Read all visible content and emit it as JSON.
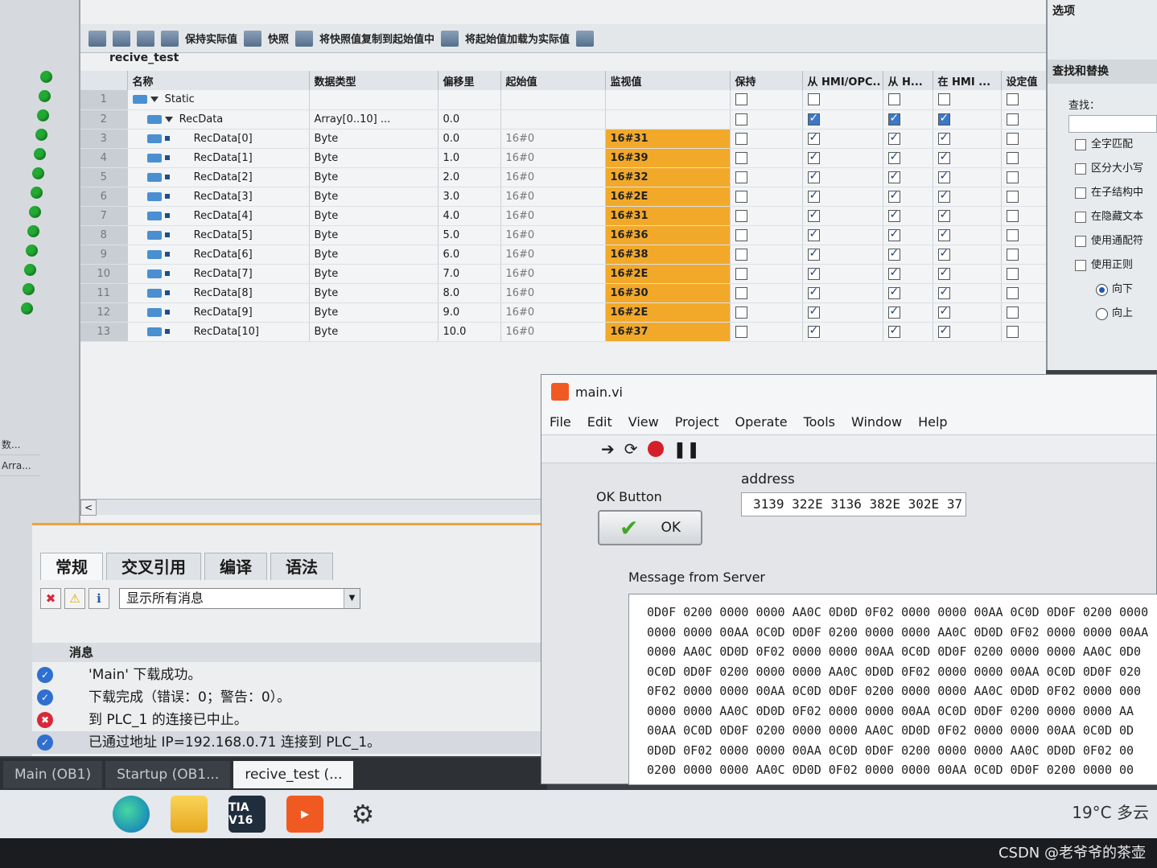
{
  "toolbar": {
    "keep_actual": "保持实际值",
    "snapshot": "快照",
    "copy_snapshot": "将快照值复制到起始值中",
    "load_start": "将起始值加载为实际值"
  },
  "block": {
    "title": "recive_test"
  },
  "grid": {
    "headers": [
      "名称",
      "数据类型",
      "偏移里",
      "起始值",
      "监视值",
      "保持",
      "从 HMI/OPC..",
      "从 H...",
      "在 HMI ...",
      "设定值"
    ],
    "static_row": {
      "num": "1",
      "name": "Static"
    },
    "array_row": {
      "num": "2",
      "name": "RecData",
      "type": "Array[0..10] ...",
      "offset": "0.0"
    },
    "rows": [
      {
        "num": "3",
        "name": "RecData[0]",
        "type": "Byte",
        "offset": "0.0",
        "start": "16#0",
        "monitor": "16#31"
      },
      {
        "num": "4",
        "name": "RecData[1]",
        "type": "Byte",
        "offset": "1.0",
        "start": "16#0",
        "monitor": "16#39"
      },
      {
        "num": "5",
        "name": "RecData[2]",
        "type": "Byte",
        "offset": "2.0",
        "start": "16#0",
        "monitor": "16#32"
      },
      {
        "num": "6",
        "name": "RecData[3]",
        "type": "Byte",
        "offset": "3.0",
        "start": "16#0",
        "monitor": "16#2E"
      },
      {
        "num": "7",
        "name": "RecData[4]",
        "type": "Byte",
        "offset": "4.0",
        "start": "16#0",
        "monitor": "16#31"
      },
      {
        "num": "8",
        "name": "RecData[5]",
        "type": "Byte",
        "offset": "5.0",
        "start": "16#0",
        "monitor": "16#36"
      },
      {
        "num": "9",
        "name": "RecData[6]",
        "type": "Byte",
        "offset": "6.0",
        "start": "16#0",
        "monitor": "16#38"
      },
      {
        "num": "10",
        "name": "RecData[7]",
        "type": "Byte",
        "offset": "7.0",
        "start": "16#0",
        "monitor": "16#2E"
      },
      {
        "num": "11",
        "name": "RecData[8]",
        "type": "Byte",
        "offset": "8.0",
        "start": "16#0",
        "monitor": "16#30"
      },
      {
        "num": "12",
        "name": "RecData[9]",
        "type": "Byte",
        "offset": "9.0",
        "start": "16#0",
        "monitor": "16#2E"
      },
      {
        "num": "13",
        "name": "RecData[10]",
        "type": "Byte",
        "offset": "10.0",
        "start": "16#0",
        "monitor": "16#37"
      }
    ]
  },
  "options": {
    "title": "选项",
    "find_replace": "查找和替换",
    "find_label": "查找：",
    "whole_word": "全字匹配",
    "match_case": "区分大小写",
    "in_substructure": "在子结构中",
    "in_hidden_text": "在隐藏文本",
    "use_wildcard": "使用通配符",
    "use_regex": "使用正则",
    "down": "向下",
    "up": "向上"
  },
  "left_labels": [
    "数...",
    "Arra..."
  ],
  "info": {
    "tabs": [
      "常规",
      "交叉引用",
      "编译",
      "语法"
    ],
    "filter": "显示所有消息",
    "msg_header": "消息",
    "messages": [
      {
        "text": "'Main' 下载成功。",
        "status": "ok"
      },
      {
        "text": "下载完成（错误：0；警告：0）。",
        "status": "ok"
      },
      {
        "text": "到 PLC_1 的连接已中止。",
        "status": "err"
      },
      {
        "text": "已通过地址 IP=192.168.0.71 连接到 PLC_1。",
        "status": "ok"
      }
    ]
  },
  "tia_tabs": [
    "Main (OB1)",
    "Startup (OB1...",
    "recive_test (..."
  ],
  "taskbar": {
    "tia_label": "TIA V16",
    "weather": "19°C 多云"
  },
  "lv": {
    "title": "main.vi",
    "menu": [
      "File",
      "Edit",
      "View",
      "Project",
      "Operate",
      "Tools",
      "Window",
      "Help"
    ],
    "ok_label": "OK Button",
    "ok_text": "OK",
    "address_label": "address",
    "address_value": "3139 322E 3136 382E 302E 37",
    "message_label": "Message from Server",
    "message_lines": [
      "0D0F 0200 0000 0000 AA0C 0D0D 0F02 0000 0000 00AA 0C0D 0D0F 0200 0000",
      "0000 0000 00AA 0C0D 0D0F 0200 0000 0000 AA0C 0D0D 0F02 0000 0000 00AA",
      "0000 AA0C 0D0D 0F02 0000 0000 00AA 0C0D 0D0F 0200 0000 0000 AA0C 0D0",
      "0C0D 0D0F 0200 0000 0000 AA0C 0D0D 0F02 0000 0000 00AA 0C0D 0D0F 020",
      "0F02 0000 0000 00AA 0C0D 0D0F 0200 0000 0000 AA0C 0D0D 0F02 0000 000",
      "0000 0000 AA0C 0D0D 0F02 0000 0000 00AA 0C0D 0D0F 0200 0000 0000 AA",
      "00AA 0C0D 0D0F 0200 0000 0000 AA0C 0D0D 0F02 0000 0000 00AA 0C0D 0D",
      "0D0D 0F02 0000 0000 00AA 0C0D 0D0F 0200 0000 0000 AA0C 0D0D 0F02 00",
      "0200 0000 0000 AA0C 0D0D 0F02 0000 0000 00AA 0C0D 0D0F 0200 0000 00"
    ]
  },
  "watermark": "CSDN @老爷爷的茶壶"
}
